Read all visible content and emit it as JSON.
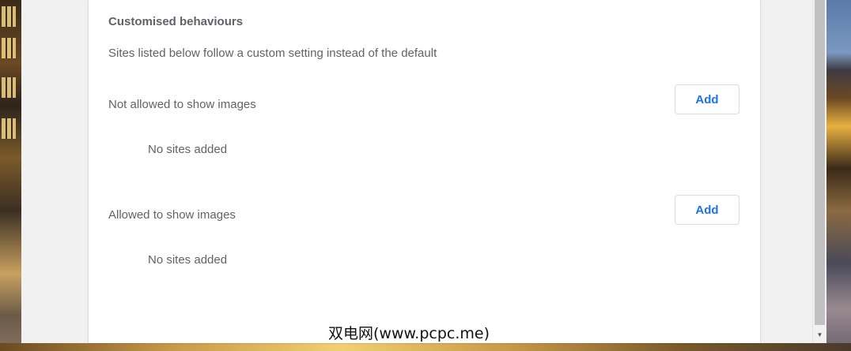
{
  "section": {
    "title": "Customised behaviours",
    "description": "Sites listed below follow a custom setting instead of the default"
  },
  "blocked": {
    "label": "Not allowed to show images",
    "add_label": "Add",
    "empty_text": "No sites added"
  },
  "allowed": {
    "label": "Allowed to show images",
    "add_label": "Add",
    "empty_text": "No sites added"
  },
  "watermark": "双电网(www.pcpc.me)",
  "colors": {
    "accent": "#1a73e8",
    "text": "#5f6368",
    "card_bg": "#ffffff",
    "page_bg": "#f1f1f1"
  }
}
